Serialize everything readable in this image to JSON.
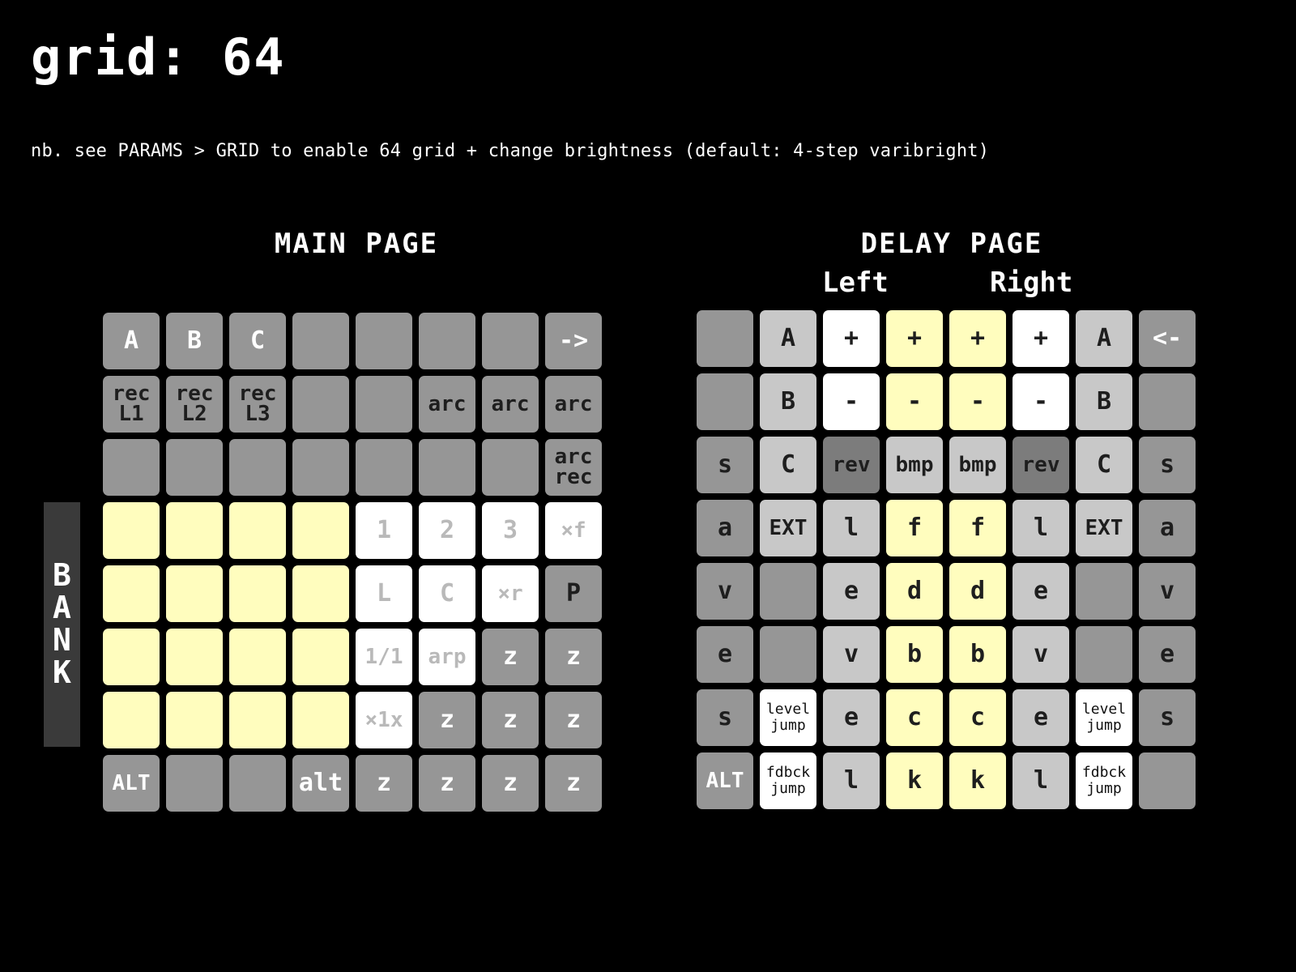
{
  "title": "grid: 64",
  "note": "nb. see PARAMS > GRID to enable 64 grid + change brightness (default: 4-step varibright)",
  "colors": {
    "background": "#000000",
    "pad_gray": "#969696",
    "pad_light_gray": "#c8c8c8",
    "pad_dark_gray": "#7c7c7c",
    "pad_yellow": "#fffdbe",
    "pad_white": "#ffffff",
    "bank_bar": "#3a3a3a"
  },
  "main_page": {
    "title": "MAIN PAGE",
    "bank_label": "BANK",
    "rows": [
      [
        {
          "t": "A",
          "c": "g",
          "f": "t-w"
        },
        {
          "t": "B",
          "c": "g",
          "f": "t-w"
        },
        {
          "t": "C",
          "c": "g",
          "f": "t-w"
        },
        {
          "t": "",
          "c": "g"
        },
        {
          "t": "",
          "c": "g"
        },
        {
          "t": "",
          "c": "g"
        },
        {
          "t": "",
          "c": "g"
        },
        {
          "t": "->",
          "c": "g",
          "f": "t-w"
        }
      ],
      [
        {
          "t": "rec\nL1",
          "c": "g",
          "f": "t-d",
          "s": "sm"
        },
        {
          "t": "rec\nL2",
          "c": "g",
          "f": "t-d",
          "s": "sm"
        },
        {
          "t": "rec\nL3",
          "c": "g",
          "f": "t-d",
          "s": "sm"
        },
        {
          "t": "",
          "c": "g"
        },
        {
          "t": "",
          "c": "g"
        },
        {
          "t": "arc",
          "c": "g",
          "f": "t-d",
          "s": "sm"
        },
        {
          "t": "arc",
          "c": "g",
          "f": "t-d",
          "s": "sm"
        },
        {
          "t": "arc",
          "c": "g",
          "f": "t-d",
          "s": "sm"
        }
      ],
      [
        {
          "t": "",
          "c": "g"
        },
        {
          "t": "",
          "c": "g"
        },
        {
          "t": "",
          "c": "g"
        },
        {
          "t": "",
          "c": "g"
        },
        {
          "t": "",
          "c": "g"
        },
        {
          "t": "",
          "c": "g"
        },
        {
          "t": "",
          "c": "g"
        },
        {
          "t": "arc\nrec",
          "c": "g",
          "f": "t-d",
          "s": "sm"
        }
      ],
      [
        {
          "t": "",
          "c": "y"
        },
        {
          "t": "",
          "c": "y"
        },
        {
          "t": "",
          "c": "y"
        },
        {
          "t": "",
          "c": "y"
        },
        {
          "t": "1",
          "c": "w",
          "f": "t-lg"
        },
        {
          "t": "2",
          "c": "w",
          "f": "t-lg"
        },
        {
          "t": "3",
          "c": "w",
          "f": "t-lg"
        },
        {
          "t": "×f",
          "c": "w",
          "f": "t-lg",
          "s": "sm"
        }
      ],
      [
        {
          "t": "",
          "c": "y"
        },
        {
          "t": "",
          "c": "y"
        },
        {
          "t": "",
          "c": "y"
        },
        {
          "t": "",
          "c": "y"
        },
        {
          "t": "L",
          "c": "w",
          "f": "t-lg"
        },
        {
          "t": "C",
          "c": "w",
          "f": "t-lg"
        },
        {
          "t": "×r",
          "c": "w",
          "f": "t-lg",
          "s": "sm"
        },
        {
          "t": "P",
          "c": "g",
          "f": "t-d"
        }
      ],
      [
        {
          "t": "",
          "c": "y"
        },
        {
          "t": "",
          "c": "y"
        },
        {
          "t": "",
          "c": "y"
        },
        {
          "t": "",
          "c": "y"
        },
        {
          "t": "1/1",
          "c": "w",
          "f": "t-lg",
          "s": "sm"
        },
        {
          "t": "arp",
          "c": "w",
          "f": "t-lg",
          "s": "sm"
        },
        {
          "t": "z",
          "c": "g",
          "f": "t-w"
        },
        {
          "t": "z",
          "c": "g",
          "f": "t-w"
        }
      ],
      [
        {
          "t": "",
          "c": "y"
        },
        {
          "t": "",
          "c": "y"
        },
        {
          "t": "",
          "c": "y"
        },
        {
          "t": "",
          "c": "y"
        },
        {
          "t": "×1x",
          "c": "w",
          "f": "t-lg",
          "s": "sm"
        },
        {
          "t": "z",
          "c": "g",
          "f": "t-w"
        },
        {
          "t": "z",
          "c": "g",
          "f": "t-w"
        },
        {
          "t": "z",
          "c": "g",
          "f": "t-w"
        }
      ],
      [
        {
          "t": "ALT",
          "c": "g",
          "f": "t-w",
          "s": "sm"
        },
        {
          "t": "",
          "c": "g"
        },
        {
          "t": "",
          "c": "g"
        },
        {
          "t": "alt",
          "c": "g",
          "f": "t-w"
        },
        {
          "t": "z",
          "c": "g",
          "f": "t-w"
        },
        {
          "t": "z",
          "c": "g",
          "f": "t-w"
        },
        {
          "t": "z",
          "c": "g",
          "f": "t-w"
        },
        {
          "t": "z",
          "c": "g",
          "f": "t-w"
        }
      ]
    ]
  },
  "delay_page": {
    "title": "DELAY PAGE",
    "left_label": "Left",
    "right_label": "Right",
    "rows": [
      [
        {
          "t": "",
          "c": "g"
        },
        {
          "t": "A",
          "c": "lg",
          "f": "t-d"
        },
        {
          "t": "+",
          "c": "w",
          "f": "t-d"
        },
        {
          "t": "+",
          "c": "y",
          "f": "t-d"
        },
        {
          "t": "+",
          "c": "y",
          "f": "t-d"
        },
        {
          "t": "+",
          "c": "w",
          "f": "t-d"
        },
        {
          "t": "A",
          "c": "lg",
          "f": "t-d"
        },
        {
          "t": "<-",
          "c": "g",
          "f": "t-w"
        }
      ],
      [
        {
          "t": "",
          "c": "g"
        },
        {
          "t": "B",
          "c": "lg",
          "f": "t-d"
        },
        {
          "t": "-",
          "c": "w",
          "f": "t-d"
        },
        {
          "t": "-",
          "c": "y",
          "f": "t-d"
        },
        {
          "t": "-",
          "c": "y",
          "f": "t-d"
        },
        {
          "t": "-",
          "c": "w",
          "f": "t-d"
        },
        {
          "t": "B",
          "c": "lg",
          "f": "t-d"
        },
        {
          "t": "",
          "c": "g"
        }
      ],
      [
        {
          "t": "s",
          "c": "g",
          "f": "t-d"
        },
        {
          "t": "C",
          "c": "lg",
          "f": "t-d"
        },
        {
          "t": "rev",
          "c": "dg",
          "f": "t-d",
          "s": "sm"
        },
        {
          "t": "bmp",
          "c": "lg",
          "f": "t-d",
          "s": "sm"
        },
        {
          "t": "bmp",
          "c": "lg",
          "f": "t-d",
          "s": "sm"
        },
        {
          "t": "rev",
          "c": "dg",
          "f": "t-d",
          "s": "sm"
        },
        {
          "t": "C",
          "c": "lg",
          "f": "t-d"
        },
        {
          "t": "s",
          "c": "g",
          "f": "t-d"
        }
      ],
      [
        {
          "t": "a",
          "c": "g",
          "f": "t-d"
        },
        {
          "t": "EXT",
          "c": "lg",
          "f": "t-d",
          "s": "sm"
        },
        {
          "t": "l",
          "c": "lg",
          "f": "t-d"
        },
        {
          "t": "f",
          "c": "y",
          "f": "t-d"
        },
        {
          "t": "f",
          "c": "y",
          "f": "t-d"
        },
        {
          "t": "l",
          "c": "lg",
          "f": "t-d"
        },
        {
          "t": "EXT",
          "c": "lg",
          "f": "t-d",
          "s": "sm"
        },
        {
          "t": "a",
          "c": "g",
          "f": "t-d"
        }
      ],
      [
        {
          "t": "v",
          "c": "g",
          "f": "t-d"
        },
        {
          "t": "",
          "c": "g"
        },
        {
          "t": "e",
          "c": "lg",
          "f": "t-d"
        },
        {
          "t": "d",
          "c": "y",
          "f": "t-d"
        },
        {
          "t": "d",
          "c": "y",
          "f": "t-d"
        },
        {
          "t": "e",
          "c": "lg",
          "f": "t-d"
        },
        {
          "t": "",
          "c": "g"
        },
        {
          "t": "v",
          "c": "g",
          "f": "t-d"
        }
      ],
      [
        {
          "t": "e",
          "c": "g",
          "f": "t-d"
        },
        {
          "t": "",
          "c": "g"
        },
        {
          "t": "v",
          "c": "lg",
          "f": "t-d"
        },
        {
          "t": "b",
          "c": "y",
          "f": "t-d"
        },
        {
          "t": "b",
          "c": "y",
          "f": "t-d"
        },
        {
          "t": "v",
          "c": "lg",
          "f": "t-d"
        },
        {
          "t": "",
          "c": "g"
        },
        {
          "t": "e",
          "c": "g",
          "f": "t-d"
        }
      ],
      [
        {
          "t": "s",
          "c": "g",
          "f": "t-d"
        },
        {
          "t": "level\njump",
          "c": "w",
          "f": "t-k",
          "s": "xs"
        },
        {
          "t": "e",
          "c": "lg",
          "f": "t-d"
        },
        {
          "t": "c",
          "c": "y",
          "f": "t-d"
        },
        {
          "t": "c",
          "c": "y",
          "f": "t-d"
        },
        {
          "t": "e",
          "c": "lg",
          "f": "t-d"
        },
        {
          "t": "level\njump",
          "c": "w",
          "f": "t-k",
          "s": "xs"
        },
        {
          "t": "s",
          "c": "g",
          "f": "t-d"
        }
      ],
      [
        {
          "t": "ALT",
          "c": "g",
          "f": "t-w",
          "s": "sm"
        },
        {
          "t": "fdbck\njump",
          "c": "w",
          "f": "t-k",
          "s": "xs"
        },
        {
          "t": "l",
          "c": "lg",
          "f": "t-d"
        },
        {
          "t": "k",
          "c": "y",
          "f": "t-d"
        },
        {
          "t": "k",
          "c": "y",
          "f": "t-d"
        },
        {
          "t": "l",
          "c": "lg",
          "f": "t-d"
        },
        {
          "t": "fdbck\njump",
          "c": "w",
          "f": "t-k",
          "s": "xs"
        },
        {
          "t": "",
          "c": "g"
        }
      ]
    ]
  }
}
